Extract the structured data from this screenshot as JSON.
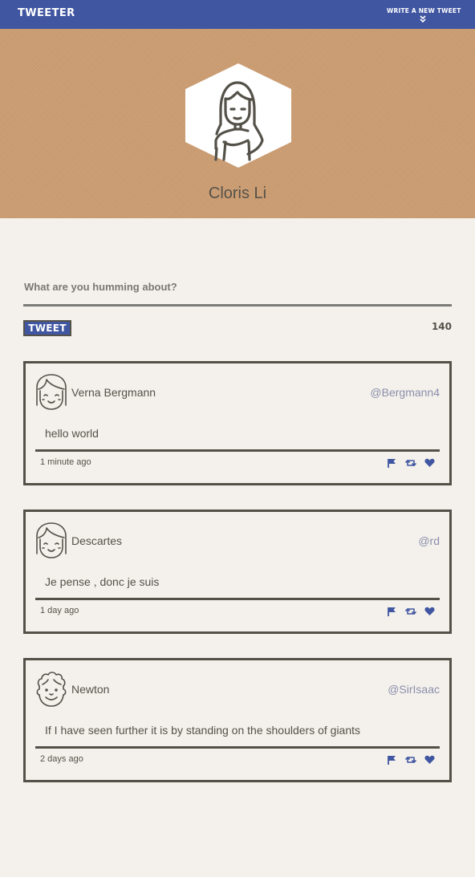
{
  "nav": {
    "brand": "TWEETER",
    "compose_label": "WRITE A NEW TWEET",
    "compose_icon": "double-chevron-down-icon"
  },
  "profile": {
    "name": "Cloris Li",
    "avatar_icon": "woman-avatar-icon"
  },
  "composer": {
    "placeholder": "What are you humming about?",
    "value": "",
    "submit_label": "TWEET",
    "counter": "140"
  },
  "tweets": [
    {
      "author": "Verna Bergmann",
      "handle": "@Bergmann4",
      "text": "hello world",
      "time": "1 minute ago",
      "avatar_icon": "girl-bangs-avatar-icon"
    },
    {
      "author": "Descartes",
      "handle": "@rd",
      "text": "Je pense , donc je suis",
      "time": "1 day ago",
      "avatar_icon": "girl-bangs-avatar-icon"
    },
    {
      "author": "Newton",
      "handle": "@SirIsaac",
      "text": "If I have seen further it is by standing on the shoulders of giants",
      "time": "2 days ago",
      "avatar_icon": "curly-hair-avatar-icon"
    }
  ],
  "action_icons": [
    "flag-icon",
    "retweet-icon",
    "heart-icon"
  ],
  "colors": {
    "nav": "#4056a1",
    "hero": "#cc9d72",
    "background": "#f4f1ec",
    "text": "#545149",
    "handle": "#8a8eab",
    "accent": "#4056a1"
  }
}
